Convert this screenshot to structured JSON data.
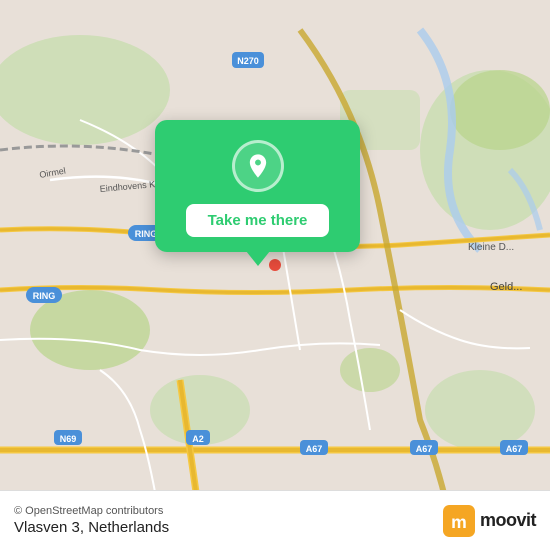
{
  "map": {
    "background_color": "#e8e0d8",
    "center_lat": 51.43,
    "center_lng": 5.47
  },
  "popup": {
    "button_label": "Take me there",
    "background_color": "#2ecc71"
  },
  "bottom_bar": {
    "osm_credit": "© OpenStreetMap contributors",
    "location_name": "Vlasven 3, Netherlands",
    "moovit_label": "moovit"
  }
}
